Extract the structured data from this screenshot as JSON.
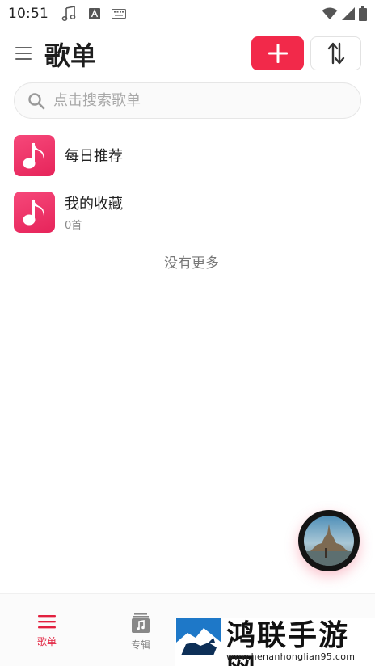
{
  "status_bar": {
    "time": "10:51",
    "icons": [
      "music-note-icon",
      "a-badge-icon",
      "keyboard-icon",
      "wifi-icon",
      "signal-icon",
      "battery-icon"
    ]
  },
  "header": {
    "title": "歌单",
    "icons": [
      "menu-icon",
      "plus-icon",
      "sort-icon"
    ]
  },
  "search": {
    "placeholder": "点击搜索歌单",
    "value": ""
  },
  "playlists": [
    {
      "name": "每日推荐",
      "count": ""
    },
    {
      "name": "我的收藏",
      "count": "0首"
    }
  ],
  "list_footer": "没有更多",
  "bottom_nav": {
    "items": [
      {
        "label": "歌单",
        "icon": "list-icon",
        "active": true
      },
      {
        "label": "专辑",
        "icon": "album-icon",
        "active": false
      }
    ]
  },
  "watermark": {
    "name": "鸿联手游网",
    "url": "www.henanhonglian95.com"
  },
  "colors": {
    "accent": "#f2294a",
    "cover": "#ec3366",
    "nav_active": "#e2213f",
    "background": "#ffffff"
  }
}
